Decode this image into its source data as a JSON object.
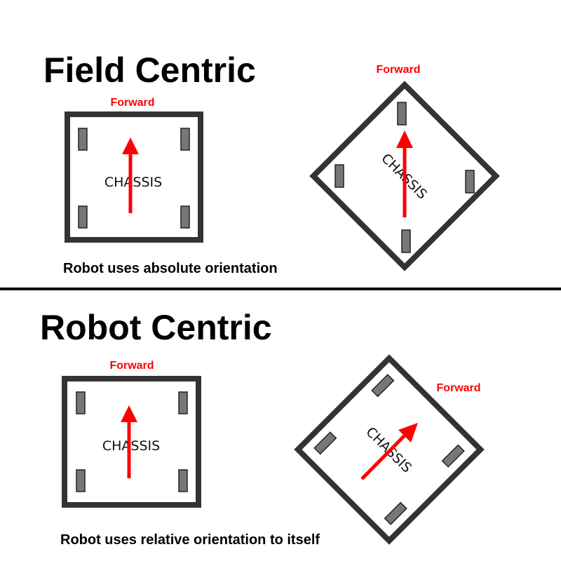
{
  "sections": {
    "field_centric": {
      "title": "Field Centric",
      "caption": "Robot uses absolute orientation",
      "robot_a": {
        "forward_label": "Forward",
        "chassis_label": "CHASSIS"
      },
      "robot_b": {
        "forward_label": "Forward",
        "chassis_label": "CHASSIS"
      }
    },
    "robot_centric": {
      "title": "Robot Centric",
      "caption": "Robot uses relative orientation to itself",
      "robot_a": {
        "forward_label": "Forward",
        "chassis_label": "CHASSIS"
      },
      "robot_b": {
        "forward_label": "Forward",
        "chassis_label": "CHASSIS"
      }
    }
  },
  "colors": {
    "arrow": "#ff0000",
    "forward_text": "#ff0000",
    "frame": "#333333",
    "wheel": "#777777",
    "divider": "#000000"
  }
}
